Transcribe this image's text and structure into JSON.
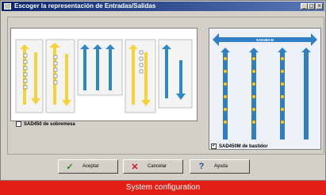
{
  "window": {
    "title": "Escoger la representación de Entradas/Salidas",
    "minimize_glyph": "_",
    "maximize_glyph": "□",
    "close_glyph": "×"
  },
  "options": {
    "desktop": {
      "label": "SAD450 de sobremesa",
      "checked": false
    },
    "rack": {
      "label": "SAD450M de bastidor",
      "checked": true,
      "check_glyph": "✓"
    }
  },
  "rack_header": "SAD450-M",
  "buttons": {
    "accept": {
      "label": "Aceptar",
      "icon": "check-icon"
    },
    "cancel": {
      "label": "Cancelar",
      "icon": "x-icon"
    },
    "help": {
      "label": "Ayuda",
      "icon": "question-icon"
    }
  },
  "caption": "System configuration",
  "colors": {
    "accent_yellow": "#f5d23a",
    "accent_blue": "#2f86c9",
    "caption_red": "#e31e14",
    "title_blue": "#0a246a"
  }
}
